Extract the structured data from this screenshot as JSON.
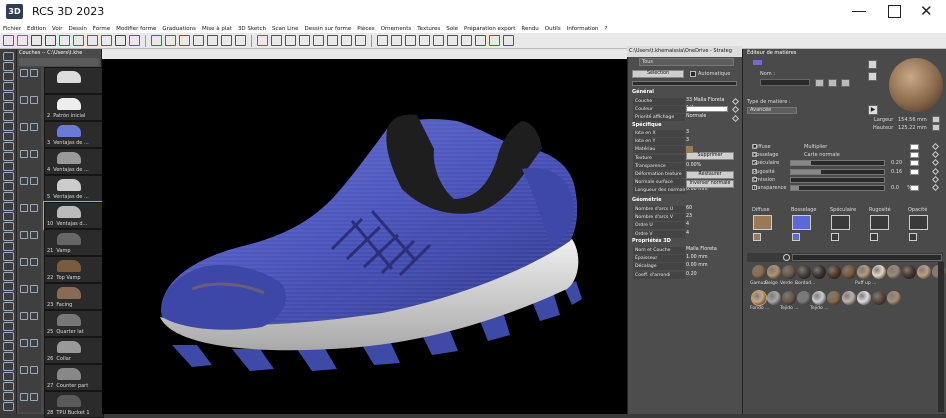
{
  "app": {
    "title": "RCS 3D 2023",
    "logo": "3D"
  },
  "menu": [
    "Fichier",
    "Edition",
    "Voir",
    "Dessin",
    "Forme",
    "Modifier forme",
    "Graduations",
    "Mise à plat",
    "3D Sketch",
    "Scan Line",
    "Dessin sur forme",
    "Pièces",
    "Ornements",
    "Textures",
    "Sole",
    "Préparation export",
    "Rendu",
    "Outils",
    "Information",
    "?"
  ],
  "layers": {
    "header": "Couches -- C:\\Users\\t.khe",
    "items": [
      {
        "num": "",
        "name": ""
      },
      {
        "num": "2",
        "name": "Patrón inicial"
      },
      {
        "num": "3",
        "name": "Ventajas de ..."
      },
      {
        "num": "4",
        "name": "Ventajas de ..."
      },
      {
        "num": "5",
        "name": "Ventajas de ..."
      },
      {
        "num": "10",
        "name": "Ventajas d..."
      },
      {
        "num": "21",
        "name": "Vamp"
      },
      {
        "num": "22",
        "name": "Top Vamp"
      },
      {
        "num": "23",
        "name": "Facing"
      },
      {
        "num": "25",
        "name": "Quarter lat"
      },
      {
        "num": "26",
        "name": "Collar"
      },
      {
        "num": "27",
        "name": "Counter part"
      },
      {
        "num": "28",
        "name": "TPU Bucket 1"
      }
    ]
  },
  "viewport": {
    "path": "C:\\Users\\t.khemaissia\\OneDrive - Strateg"
  },
  "props": {
    "dropdown": "Tous",
    "select_btn": "Sélection",
    "auto_label": "Automatique",
    "sections": [
      "Général",
      "Spécifique",
      "Géométrie",
      "Propriétés 3D"
    ],
    "general": [
      {
        "label": "Couche",
        "value": "33 Malla Floreta"
      },
      {
        "label": "Couleur",
        "value": "1/4"
      },
      {
        "label": "Priorité affichage",
        "value": "Normale"
      }
    ],
    "specific": [
      {
        "label": "Iota en X",
        "value": "3"
      },
      {
        "label": "Iota en Y",
        "value": "3"
      },
      {
        "label": "Matériau",
        "value": ""
      },
      {
        "label": "Texture",
        "value": ""
      },
      {
        "label": "Transparence",
        "value": "0.00%"
      },
      {
        "label": "Déformation texture",
        "value": ""
      },
      {
        "label": "Normale surface",
        "value": ""
      },
      {
        "label": "Longueur des normales",
        "value": "0.00 mm"
      }
    ],
    "btns": {
      "suppress": "Supprimer",
      "restore": "Restaurer",
      "invert": "Inverser normale"
    },
    "geometry": [
      {
        "label": "Nombre d'arcs U",
        "value": "60"
      },
      {
        "label": "Nombre d'arcs V",
        "value": "23"
      },
      {
        "label": "Ordre U",
        "value": "4"
      },
      {
        "label": "Ordre V",
        "value": "4"
      }
    ],
    "props3d": [
      {
        "label": "Nom et Couche",
        "value": "Malla Floreta"
      },
      {
        "label": "Épaisseur",
        "value": "1.00 mm"
      },
      {
        "label": "Décalage",
        "value": "0.00 mm"
      },
      {
        "label": "Coeff. d'arrondi",
        "value": "0.20"
      }
    ]
  },
  "material": {
    "title": "Éditeur de matières",
    "name_label": "Nom :",
    "type_label": "Type de matière :",
    "type_value": "Avancée",
    "largeur_label": "Largeur",
    "largeur_value": "154.56",
    "hauteur_label": "Hauteur",
    "hauteur_value": "125.22",
    "unit": "mm",
    "channels": [
      {
        "label": "Diffuse",
        "value": "Multiplier"
      },
      {
        "label": "Bosselage",
        "value": "Carte normale"
      },
      {
        "label": "Spéculaire",
        "value": "0.20"
      },
      {
        "label": "Rugosité",
        "value": "0.16"
      },
      {
        "label": "Émission",
        "value": ""
      },
      {
        "label": "Transparence",
        "value": "0.0"
      }
    ],
    "percent": "%",
    "map_labels": [
      "Diffuse",
      "Bosselage",
      "Spéculaire",
      "Rugosité",
      "Opacité"
    ],
    "library_row1": [
      "Gamuz...",
      "Beige ...",
      "Verde ...",
      "Bordad...",
      "",
      "",
      "",
      "Puff up ..."
    ],
    "library_row2": [
      "Fondo ...",
      "",
      "Tejido ...",
      "",
      "Tejido ..."
    ]
  }
}
